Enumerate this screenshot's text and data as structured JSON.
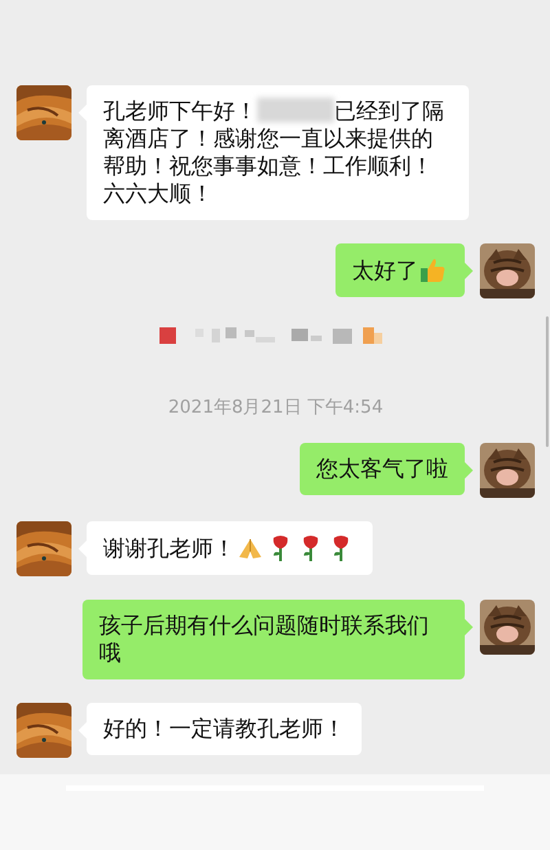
{
  "messages": [
    {
      "kind": "incoming",
      "parts": [
        {
          "kind": "text",
          "text": "孔老师下午好！"
        },
        {
          "kind": "redacted"
        },
        {
          "kind": "text",
          "text": "已经到了隔离酒店了！感谢您一直以来提供的帮助！祝您事事如意！工作顺利！六六大顺！"
        }
      ]
    },
    {
      "kind": "outgoing",
      "parts": [
        {
          "kind": "text",
          "text": "太好了"
        },
        {
          "kind": "thumbs_up"
        }
      ]
    },
    {
      "kind": "notice"
    },
    {
      "kind": "time",
      "text": "2021年8月21日 下午4:54"
    },
    {
      "kind": "outgoing",
      "parts": [
        {
          "kind": "text",
          "text": "您太客气了啦"
        }
      ]
    },
    {
      "kind": "incoming",
      "parts": [
        {
          "kind": "text",
          "text": "谢谢孔老师！"
        },
        {
          "kind": "folded_hands"
        },
        {
          "kind": "rose"
        },
        {
          "kind": "rose"
        },
        {
          "kind": "rose"
        }
      ]
    },
    {
      "kind": "outgoing",
      "parts": [
        {
          "kind": "text",
          "text": "孩子后期有什么问题随时联系我们哦"
        }
      ]
    },
    {
      "kind": "incoming",
      "parts": [
        {
          "kind": "text",
          "text": "好的！一定请教孔老师！"
        }
      ]
    }
  ]
}
